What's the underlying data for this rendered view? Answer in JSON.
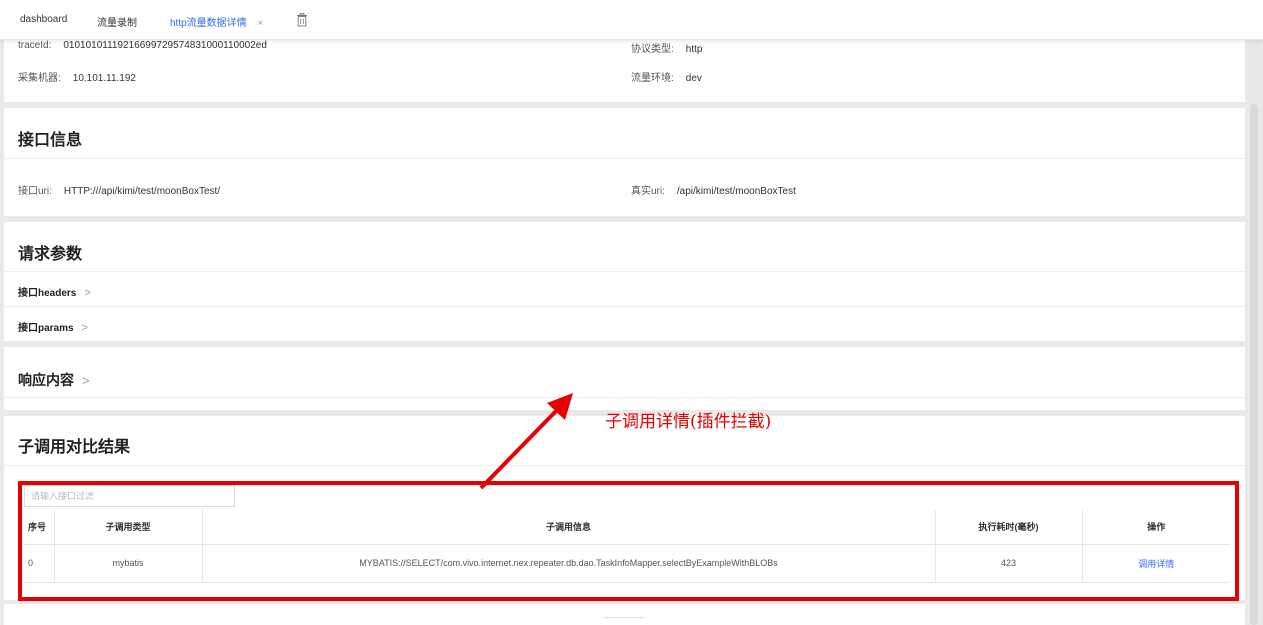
{
  "tabs": [
    {
      "label": "dashboard"
    },
    {
      "label": "流量录制"
    },
    {
      "label": "http流量数据详情",
      "close": "×"
    }
  ],
  "basic_info": {
    "traceid_label": "traceId:",
    "traceid_value": "01010101119216699729574831000110002ed",
    "protocol_label": "协议类型:",
    "protocol_value": "http",
    "machine_label": "采集机器:",
    "machine_value": "10.101.11.192",
    "env_label": "流量环境:",
    "env_value": "dev"
  },
  "interface_info": {
    "title": "接口信息",
    "uri_label": "接口uri:",
    "uri_value": "HTTP:///api/kimi/test/moonBoxTest/",
    "real_uri_label": "真实uri:",
    "real_uri_value": "/api/kimi/test/moonBoxTest"
  },
  "request_params": {
    "title": "请求参数",
    "headers_label": "接口headers",
    "params_label": "接口params"
  },
  "response": {
    "title": "响应内容"
  },
  "sub_call": {
    "title": "子调用对比结果",
    "filter_placeholder": "请输入接口过滤",
    "columns": [
      "序号",
      "子调用类型",
      "子调用信息",
      "执行耗时(毫秒)",
      "操作"
    ],
    "rows": [
      {
        "index": "0",
        "type": "mybatis",
        "info": "MYBATIS://SELECT/com.vivo.internet.nex.repeater.db.dao.TaskInfoMapper.selectByExampleWithBLOBs",
        "duration": "423",
        "action": "调用详情"
      }
    ]
  },
  "annotation": {
    "text": "子调用详情(插件拦截)",
    "color": "#e60000"
  },
  "icons": {
    "trash": "trash-icon",
    "chevron": "chevron-right-icon"
  },
  "colors": {
    "accent": "#2f6bff",
    "annotation": "#e60000"
  }
}
